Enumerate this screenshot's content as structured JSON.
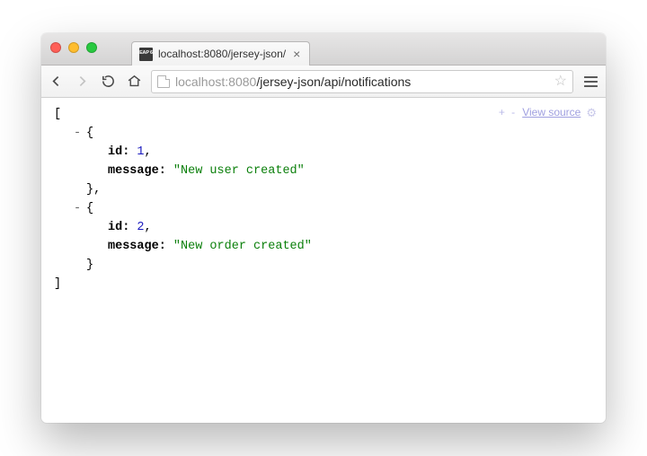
{
  "tab": {
    "title": "localhost:8080/jersey-json/",
    "favicon_text": "EAP\n6"
  },
  "address": {
    "host_dim_prefix": "localhost",
    "host_dim_port": ":8080",
    "path": "/jersey-json/api/notifications"
  },
  "viewer": {
    "plus_minus": "+ -",
    "view_source": "View source"
  },
  "json": {
    "open_bracket": "[",
    "close_bracket": "]",
    "open_brace": "{",
    "close_brace_comma": "},",
    "close_brace": "}",
    "items": [
      {
        "id_key": "id:",
        "id_val": "1",
        "id_comma": ",",
        "msg_key": "message:",
        "msg_val": "\"New user created\""
      },
      {
        "id_key": "id:",
        "id_val": "2",
        "id_comma": ",",
        "msg_key": "message:",
        "msg_val": "\"New order created\""
      }
    ]
  }
}
